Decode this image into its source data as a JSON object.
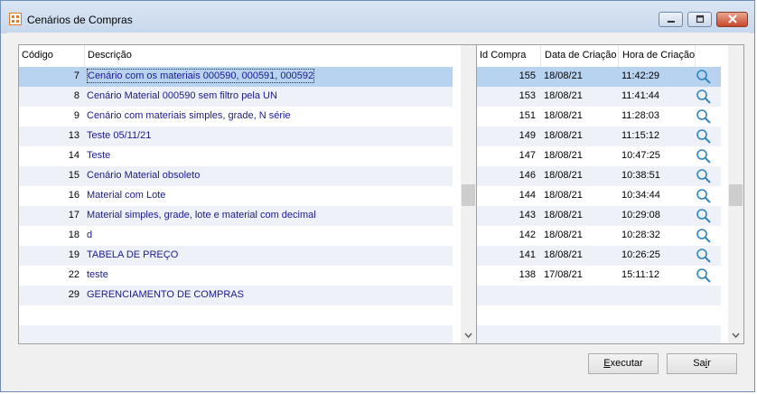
{
  "window": {
    "title": "Cenários de Compras",
    "colors": {
      "accent_text": "#1a1a8c",
      "selection": "#b8d3f0",
      "alt_row": "#eef2f8",
      "icon": "#2e86c1"
    }
  },
  "scenarios": {
    "headers": {
      "code": "Código",
      "description": "Descrição"
    },
    "rows": [
      {
        "code": "7",
        "description": "Cenário com os materiais 000590, 000591, 000592",
        "selected": true
      },
      {
        "code": "8",
        "description": "Cenário Material 000590 sem filtro pela UN"
      },
      {
        "code": "9",
        "description": "Cenário com materiais simples, grade, N série"
      },
      {
        "code": "13",
        "description": "Teste 05/11/21"
      },
      {
        "code": "14",
        "description": "Teste"
      },
      {
        "code": "15",
        "description": "Cenário Material obsoleto"
      },
      {
        "code": "16",
        "description": "Material com Lote"
      },
      {
        "code": "17",
        "description": "Material simples, grade, lote e material com decimal"
      },
      {
        "code": "18",
        "description": "d"
      },
      {
        "code": "19",
        "description": "TABELA DE PREÇO"
      },
      {
        "code": "22",
        "description": "teste"
      },
      {
        "code": "29",
        "description": "GERENCIAMENTO DE COMPRAS"
      }
    ]
  },
  "purchases": {
    "headers": {
      "id": "Id Compra",
      "date": "Data de Criação",
      "time": "Hora de Criação"
    },
    "rows": [
      {
        "id": "155",
        "date": "18/08/21",
        "time": "11:42:29",
        "icon": "search-icon",
        "selected": true
      },
      {
        "id": "153",
        "date": "18/08/21",
        "time": "11:41:44",
        "icon": "search-icon"
      },
      {
        "id": "151",
        "date": "18/08/21",
        "time": "11:28:03",
        "icon": "search-icon"
      },
      {
        "id": "149",
        "date": "18/08/21",
        "time": "11:15:12",
        "icon": "search-icon"
      },
      {
        "id": "147",
        "date": "18/08/21",
        "time": "10:47:25",
        "icon": "search-icon"
      },
      {
        "id": "146",
        "date": "18/08/21",
        "time": "10:38:51",
        "icon": "search-icon"
      },
      {
        "id": "144",
        "date": "18/08/21",
        "time": "10:34:44",
        "icon": "search-icon"
      },
      {
        "id": "143",
        "date": "18/08/21",
        "time": "10:29:08",
        "icon": "search-icon"
      },
      {
        "id": "142",
        "date": "18/08/21",
        "time": "10:28:32",
        "icon": "search-icon"
      },
      {
        "id": "141",
        "date": "18/08/21",
        "time": "10:26:25",
        "icon": "search-icon"
      },
      {
        "id": "138",
        "date": "17/08/21",
        "time": "15:11:12",
        "icon": "search-icon"
      }
    ]
  },
  "buttons": {
    "execute": {
      "accel": "E",
      "rest": "xecutar"
    },
    "exit": {
      "before": "Sa",
      "accel": "i",
      "rest": "r"
    }
  }
}
